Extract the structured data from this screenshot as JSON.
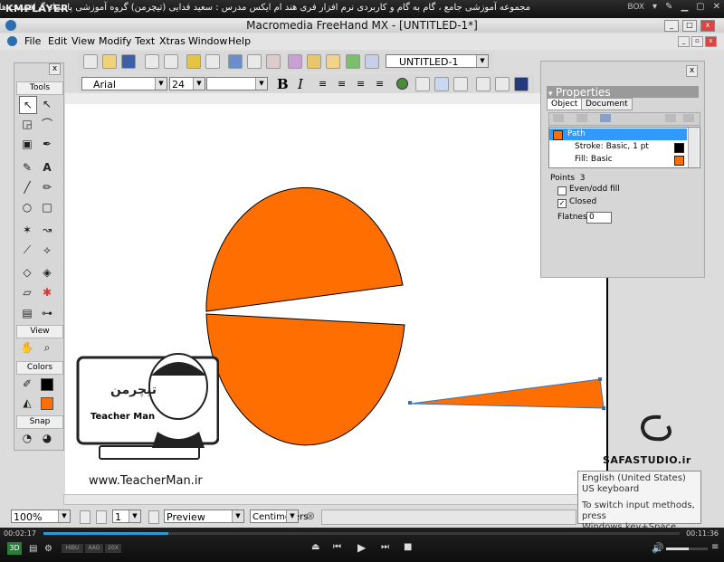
{
  "player": {
    "logo": "KMPLAYER",
    "title": "مجموعه آموزشی جامع ، گام به گام و کاربردی نرم افزار فری هند ام ایکس  مدرس : سعید فدایی (تیچرمن) گروه آموزشی پادشاه گرافیست ها",
    "box_label": "BOX",
    "time_current": "00:02:17",
    "time_total": "00:11:36",
    "progress_fraction": 0.196,
    "mode_3d": "3D",
    "buttons_small": [
      "HIBU",
      "AAO",
      "20X"
    ],
    "volume_fraction": 0.55
  },
  "app": {
    "title": "Macromedia FreeHand MX - [UNTITLED-1*]",
    "menu": [
      "File",
      "Edit",
      "View",
      "Modify",
      "Text",
      "Xtras",
      "Window",
      "Help"
    ],
    "doc_name": "UNTITLED-1",
    "font_name": "Arial",
    "font_size": "24",
    "bold_label": "B",
    "italic_label": "I"
  },
  "tools": {
    "close": "x",
    "sections": [
      "Tools",
      "View",
      "Colors",
      "Snap"
    ]
  },
  "properties": {
    "title": "Properties",
    "close": "x",
    "tabs": [
      "Object",
      "Document"
    ],
    "rows": [
      {
        "label": "Path",
        "swatch": "#ff6e00"
      },
      {
        "label": "Stroke: Basic, 1 pt",
        "swatch": "#000000"
      },
      {
        "label": "Fill: Basic",
        "swatch": "#ff6e00"
      }
    ],
    "points_label": "Points",
    "points_value": "3",
    "evenodd_label": "Even/odd fill",
    "closed_label": "Closed",
    "flatness_label": "Flatness:",
    "flatness_value": "0"
  },
  "status": {
    "zoom": "100%",
    "page": "1",
    "mode": "Preview",
    "units": "Centimeters"
  },
  "watermark": {
    "site": "www.TeacherMan.ir",
    "brand": "Teacher Man",
    "safa": "SAFASTUDIO.ir"
  },
  "ime_tooltip": {
    "line1": "English (United States)",
    "line2": "US keyboard",
    "line3": "To switch input methods, press",
    "line4": "Windows key+Space."
  },
  "colors": {
    "shape_fill": "#ff6e00",
    "accent_blue": "#3399ff"
  }
}
